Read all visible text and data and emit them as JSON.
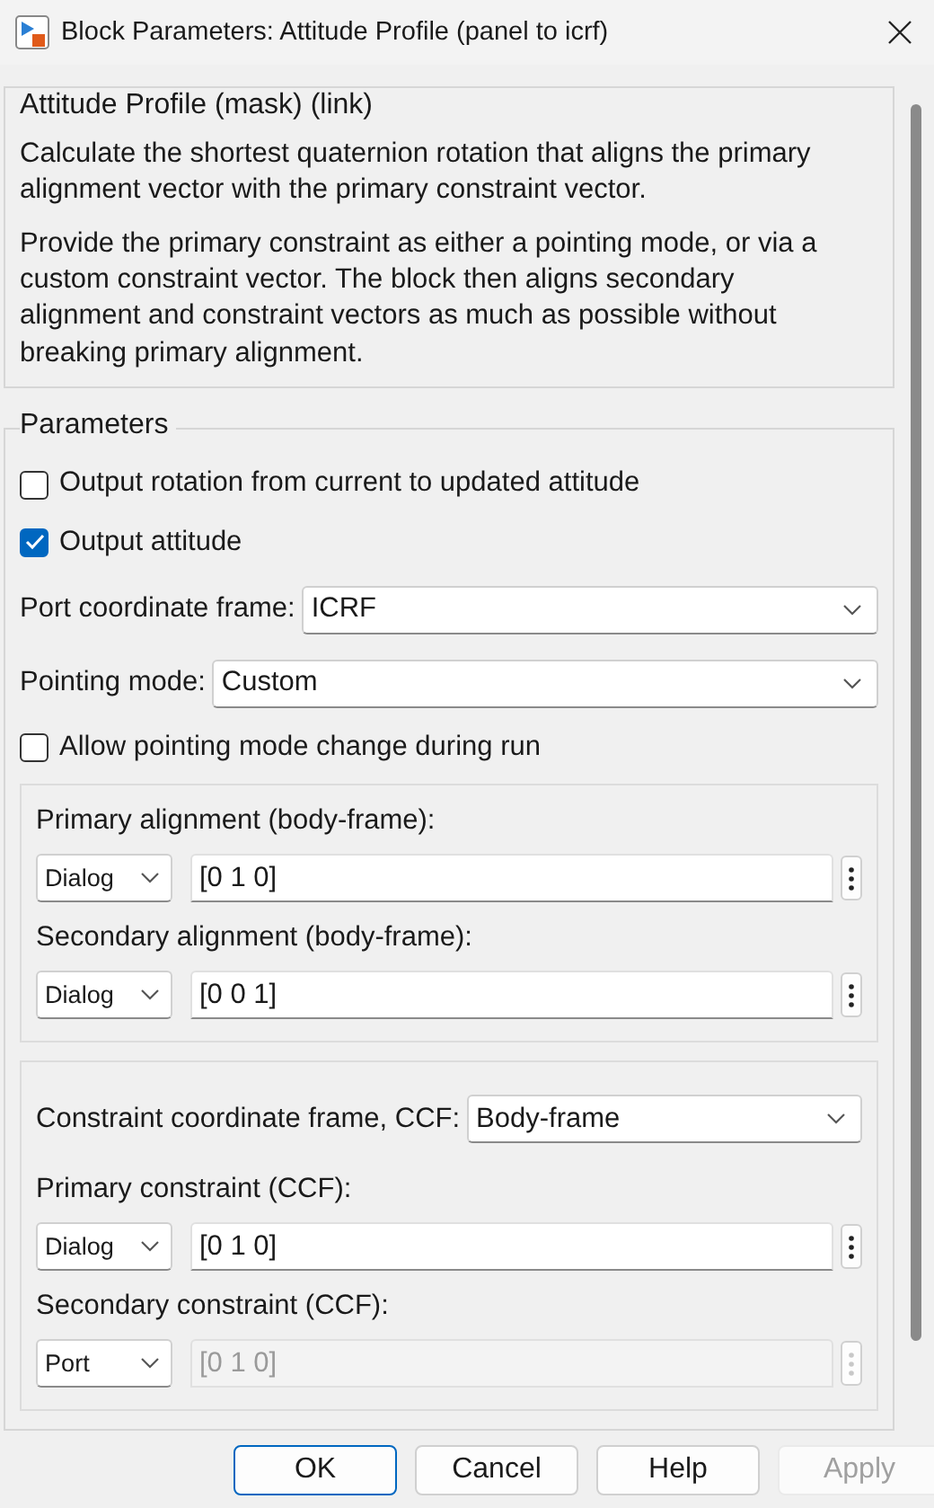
{
  "window": {
    "title": "Block Parameters: Attitude Profile (panel to icrf)"
  },
  "description": {
    "title": "Attitude Profile (mask) (link)",
    "paragraphs": [
      "Calculate the shortest quaternion rotation that aligns the primary alignment vector with the primary constraint vector.",
      "Provide the primary constraint as either a pointing mode, or via a custom constraint vector. The block then aligns secondary alignment and constraint vectors as much as possible without breaking primary alignment."
    ]
  },
  "parameters": {
    "title": "Parameters",
    "rows": [
      {
        "kind": "checkbox",
        "label": "Output rotation from current to updated attitude",
        "checked": false
      },
      {
        "kind": "checkbox",
        "label": "Output attitude",
        "checked": true
      },
      {
        "kind": "select",
        "label": "Port coordinate frame:",
        "value": "ICRF"
      },
      {
        "kind": "select",
        "label": "Pointing mode:",
        "value": "Custom"
      },
      {
        "kind": "checkbox",
        "label": "Allow pointing mode change during run",
        "checked": false
      }
    ],
    "groups": [
      {
        "rows": [
          {
            "kind": "vector",
            "label": "Primary alignment (body-frame):",
            "source": "Dialog",
            "value": "[0 1 0]",
            "disabled": false
          },
          {
            "kind": "vector",
            "label": "Secondary alignment (body-frame):",
            "source": "Dialog",
            "value": "[0 0 1]",
            "disabled": false
          }
        ]
      },
      {
        "rows": [
          {
            "kind": "select",
            "label": "Constraint coordinate frame, CCF:",
            "value": "Body-frame"
          },
          {
            "kind": "vector",
            "label": "Primary constraint (CCF):",
            "source": "Dialog",
            "value": "[0 1 0]",
            "disabled": false
          },
          {
            "kind": "vector",
            "label": "Secondary constraint (CCF):",
            "source": "Port",
            "value": "[0 1 0]",
            "disabled": true
          }
        ]
      }
    ]
  },
  "buttons": [
    {
      "label": "OK",
      "default": true,
      "disabled": false
    },
    {
      "label": "Cancel",
      "default": false,
      "disabled": false
    },
    {
      "label": "Help",
      "default": false,
      "disabled": false
    },
    {
      "label": "Apply",
      "default": false,
      "disabled": true
    }
  ]
}
